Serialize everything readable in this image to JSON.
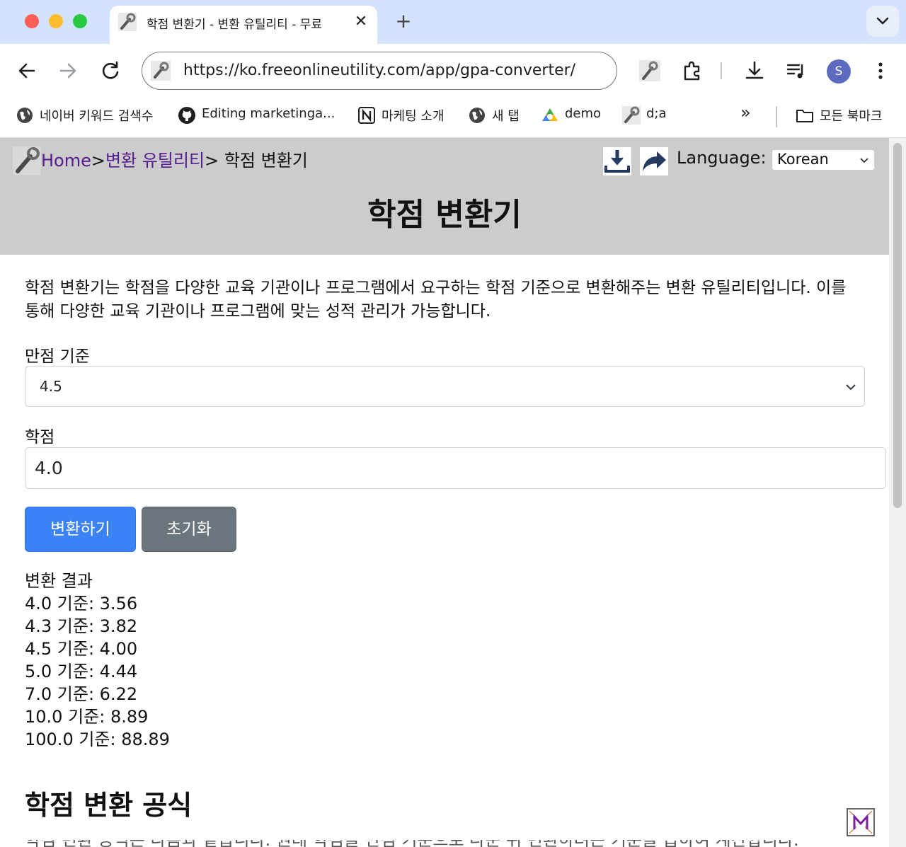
{
  "browser": {
    "tab": {
      "title": "학점 변환기 - 변환 유틸리티 - 무료",
      "close_glyph": "✕"
    },
    "new_tab_glyph": "+",
    "address": {
      "url": "https://ko.freeonlineutility.com/app/gpa-converter/"
    },
    "profile_initial": "S",
    "bookmarks": [
      {
        "label": "네이버 키워드 검색수",
        "icon": "globe-icon"
      },
      {
        "label": "Editing marketinga...",
        "icon": "github-icon"
      },
      {
        "label": "마케팅 소개",
        "icon": "notion-icon"
      },
      {
        "label": "새 탭",
        "icon": "globe-icon"
      },
      {
        "label": "demo",
        "icon": "drive-icon"
      },
      {
        "label": "d;a",
        "icon": "wrench-icon"
      }
    ],
    "overflow_glyph": "»",
    "all_bookmarks_label": "모든 북마크"
  },
  "header": {
    "breadcrumb": {
      "home": "Home",
      "sep1": ">",
      "category": "변환 유틸리티",
      "sep2": ">",
      "current": " 학점 변환기"
    },
    "language_label": "Language:",
    "language_value": "Korean",
    "title": "학점 변환기"
  },
  "main": {
    "intro": "학점 변환기는 학점을 다양한 교육 기관이나 프로그램에서 요구하는 학점 기준으로 변환해주는 변환 유틸리티입니다. 이를 통해 다양한 교육 기관이나 프로그램에 맞는 성적 관리가 가능합니다.",
    "scale_label": "만점 기준",
    "scale_value": "4.5",
    "gpa_label": "학점",
    "gpa_value": "4.0",
    "convert_button": "변환하기",
    "reset_button": "초기화",
    "results_title": "변환 결과",
    "results": [
      "4.0 기준: 3.56",
      "4.3 기준: 3.82",
      "4.5 기준: 4.00",
      "5.0 기준: 4.44",
      "7.0 기준: 6.22",
      "10.0 기준: 8.89",
      "100.0 기준: 88.89"
    ],
    "section_title": "학점 변환 공식",
    "cut_text": "학점 변환 공식은 다음과 같습니다. 원래 학점을 만점 기준으로 나눈 뒤 변환하려는 기준을 곱하여 계산합니다."
  },
  "colors": {
    "tabstrip": "#d3e3fd",
    "header_bg": "#cccccc",
    "primary_button": "#3b82f6",
    "secondary_button": "#6c757d",
    "link": "#1a0dab",
    "link_visited": "#551a8b"
  }
}
